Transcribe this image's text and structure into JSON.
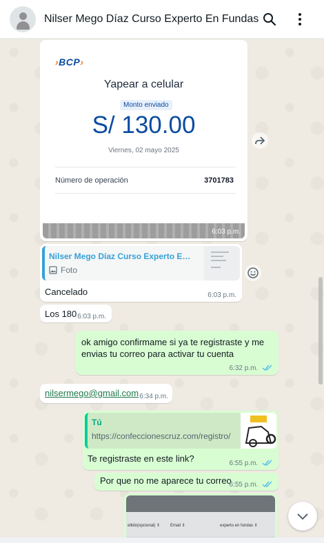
{
  "header": {
    "title": "Nilser Mego Díaz Curso Experto En Fundas",
    "icons": [
      "avatar-placeholder-icon",
      "search-icon",
      "more-vertical-icon"
    ]
  },
  "messages": {
    "receipt": {
      "brand": "BCP",
      "title": "Yapear a celular",
      "badge": "Monto enviado",
      "amount": "S/ 130.00",
      "date": "Viernes, 02 mayo 2025",
      "op_label": "Número de operación",
      "op_number": "3701783",
      "time": "6:03 p.m."
    },
    "reply_cancelado": {
      "quote_name": "Nilser Mego Díaz Curso Experto En Fundas",
      "quote_type": "Foto",
      "text": "Cancelado",
      "time": "6:03 p.m."
    },
    "los180": {
      "text": "Los 180",
      "time": "6:03 p.m."
    },
    "confirm": {
      "text": "ok amigo confirmame si ya te registraste y me envias tu correo para activar tu cuenta",
      "time": "6:32 p.m."
    },
    "email": {
      "text": "nilsermego@gmail.com",
      "time": "6:34 p.m."
    },
    "link_question": {
      "quote_name": "Tú",
      "quote_link": "https://confeccionescruz.com/registro/",
      "text": "Te registraste en este link?",
      "time": "6:55 p.m."
    },
    "why": {
      "text": "Por que no me aparece tu correo",
      "time": "6:55 p.m."
    },
    "photo": {
      "labels": [
        "ellido(opcional) ⇕",
        "Email ⇕",
        "experto en fundas ⇕"
      ]
    }
  },
  "colors": {
    "incoming": "#ffffff",
    "outgoing": "#d9fdd3",
    "read_ticks": "#53bdeb",
    "bcp_blue": "#0a4ba1",
    "bcp_orange": "#f47b20"
  }
}
